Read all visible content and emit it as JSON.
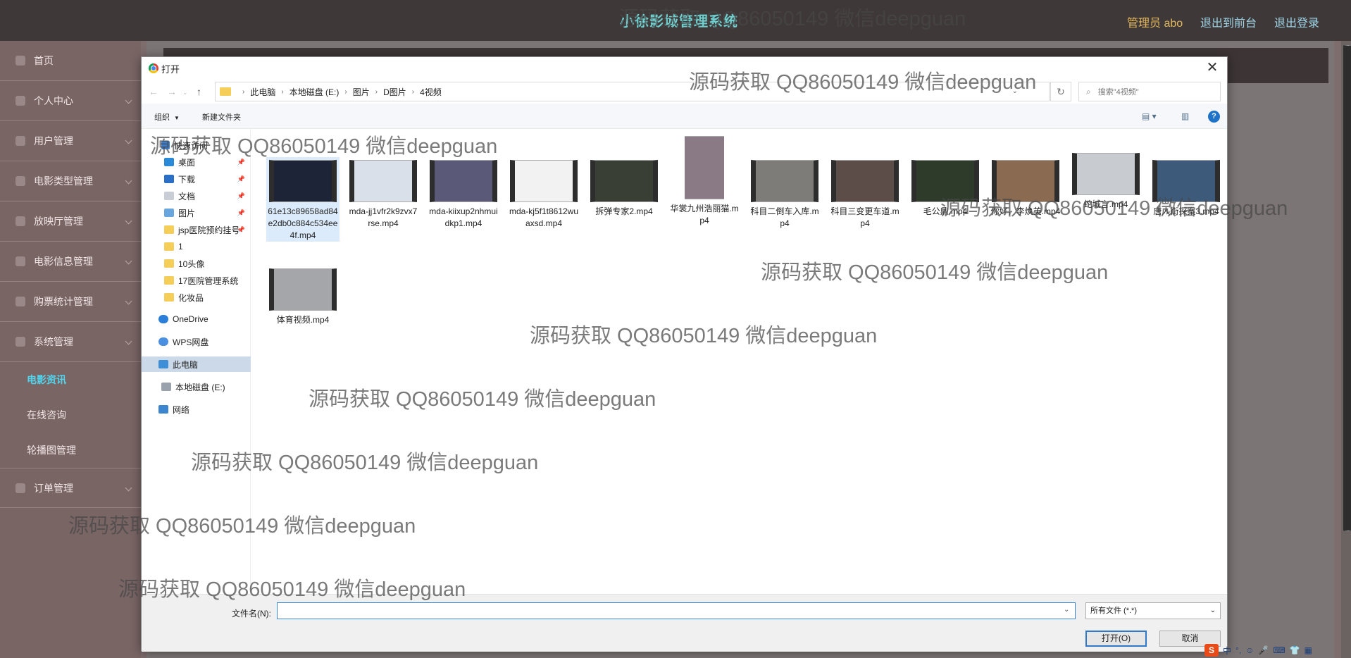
{
  "app": {
    "title": "小徐影城管理系统",
    "admin_label": "管理员 abo",
    "back_front": "退出到前台",
    "logout": "退出登录"
  },
  "sidebar": {
    "items": [
      {
        "label": "首页",
        "icon": "home-icon"
      },
      {
        "label": "个人中心",
        "icon": "person-icon"
      },
      {
        "label": "用户管理",
        "icon": "users-icon"
      },
      {
        "label": "电影类型管理",
        "icon": "category-icon"
      },
      {
        "label": "放映厅管理",
        "icon": "hall-icon"
      },
      {
        "label": "电影信息管理",
        "icon": "film-icon"
      },
      {
        "label": "购票统计管理",
        "icon": "ticket-icon"
      },
      {
        "label": "系统管理",
        "icon": "system-icon"
      }
    ],
    "subitems": [
      {
        "label": "电影资讯",
        "active": true
      },
      {
        "label": "在线咨询",
        "active": false
      },
      {
        "label": "轮播图管理",
        "active": false
      }
    ],
    "last_item": {
      "label": "订单管理",
      "icon": "order-icon"
    }
  },
  "dialog": {
    "title": "打开",
    "breadcrumb": [
      "此电脑",
      "本地磁盘 (E:)",
      "图片",
      "D图片",
      "4视频"
    ],
    "search_placeholder": "搜索\"4视频\"",
    "toolbar": {
      "organize": "组织",
      "new_folder": "新建文件夹"
    },
    "nav": [
      {
        "label": "快速访问",
        "icon": "star-icon",
        "pinned": false
      },
      {
        "label": "桌面",
        "icon": "desktop-icon",
        "pinned": true
      },
      {
        "label": "下载",
        "icon": "download-icon",
        "pinned": true
      },
      {
        "label": "文档",
        "icon": "document-icon",
        "pinned": true
      },
      {
        "label": "图片",
        "icon": "picture-icon",
        "pinned": true
      },
      {
        "label": "jsp医院预约挂号",
        "icon": "folder-icon",
        "pinned": true
      },
      {
        "label": "1",
        "icon": "folder-icon",
        "pinned": false
      },
      {
        "label": "10头像",
        "icon": "folder-icon",
        "pinned": false
      },
      {
        "label": "17医院管理系统",
        "icon": "folder-icon",
        "pinned": false
      },
      {
        "label": "化妆品",
        "icon": "folder-icon",
        "pinned": false
      },
      {
        "label": "OneDrive",
        "icon": "cloud-icon",
        "pinned": false
      },
      {
        "label": "WPS网盘",
        "icon": "cloud-icon",
        "pinned": false
      },
      {
        "label": "此电脑",
        "icon": "computer-icon",
        "pinned": false
      },
      {
        "label": "本地磁盘 (E:)",
        "icon": "drive-icon",
        "pinned": false
      },
      {
        "label": "网络",
        "icon": "network-icon",
        "pinned": false
      }
    ],
    "files": [
      {
        "name": "61e13c89658ad84e2db0c884c534ee4f.mp4",
        "color": "#1d2438"
      },
      {
        "name": "mda-jj1vfr2k9zvx7rse.mp4",
        "color": "#d9e0ea"
      },
      {
        "name": "mda-kiixup2nhmuidkp1.mp4",
        "color": "#5a5a78"
      },
      {
        "name": "mda-kj5f1t8612wuaxsd.mp4",
        "color": "#f2f2f2"
      },
      {
        "name": "拆弹专家2.mp4",
        "color": "#3a3f36"
      },
      {
        "name": "华裳九州浩丽猫.mp4",
        "color": "#8a7a86"
      },
      {
        "name": "科目二倒车入库.mp4",
        "color": "#7d7c78"
      },
      {
        "name": "科目三变更车道.mp4",
        "color": "#5d4d48"
      },
      {
        "name": "毛公鼎.mp4",
        "color": "#2f3b2a"
      },
      {
        "name": "你好，李焕英.mp4",
        "color": "#8a6a50"
      },
      {
        "name": "蛇城言.mp4",
        "color": "#c8ccd0"
      },
      {
        "name": "唐人街探案3.mp4",
        "color": "#3d5a7a"
      },
      {
        "name": "体育视频.mp4",
        "color": "#a4a6aa"
      }
    ],
    "filename_label": "文件名(N):",
    "filename_value": "",
    "filter": "所有文件 (*.*)",
    "open_button": "打开(O)",
    "cancel_button": "取消"
  },
  "tray": {
    "ime": "S",
    "lang": "中"
  },
  "watermark": "源码获取 QQ86050149 微信deepguan"
}
